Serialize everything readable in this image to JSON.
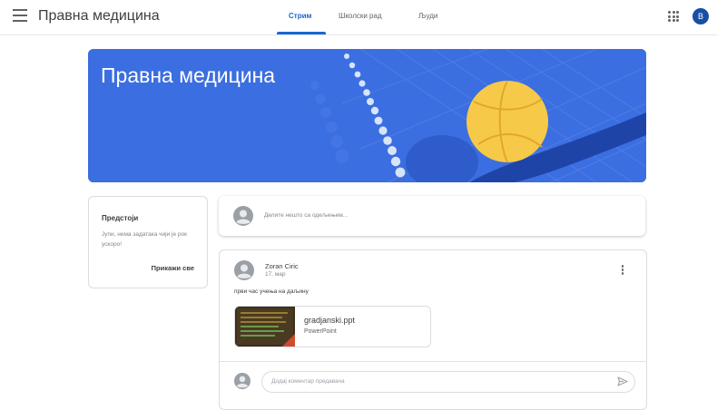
{
  "header": {
    "class_name": "Правна медицина",
    "tabs": [
      {
        "label": "Стрим",
        "active": true
      },
      {
        "label": "Школски рад",
        "active": false
      },
      {
        "label": "Људи",
        "active": false
      }
    ],
    "avatar_initial": "В",
    "avatar_color": "#174ea6",
    "accent_color": "#1967d2"
  },
  "banner": {
    "title": "Правна медицина",
    "color": "#3b6ee0"
  },
  "upcoming": {
    "title": "Предстоји",
    "text": "Јупи, нема задатака чији је рок ускоро!",
    "link": "Прикажи све"
  },
  "share": {
    "placeholder": "Делите нешто са одељењем..."
  },
  "post": {
    "author": "Zoran Ciric",
    "date": "17. мар",
    "text": "први час учења на даљину",
    "attachment": {
      "name": "gradjanski.ppt",
      "type": "PowerPoint"
    },
    "comment_placeholder": "Додај коментар предавача"
  }
}
